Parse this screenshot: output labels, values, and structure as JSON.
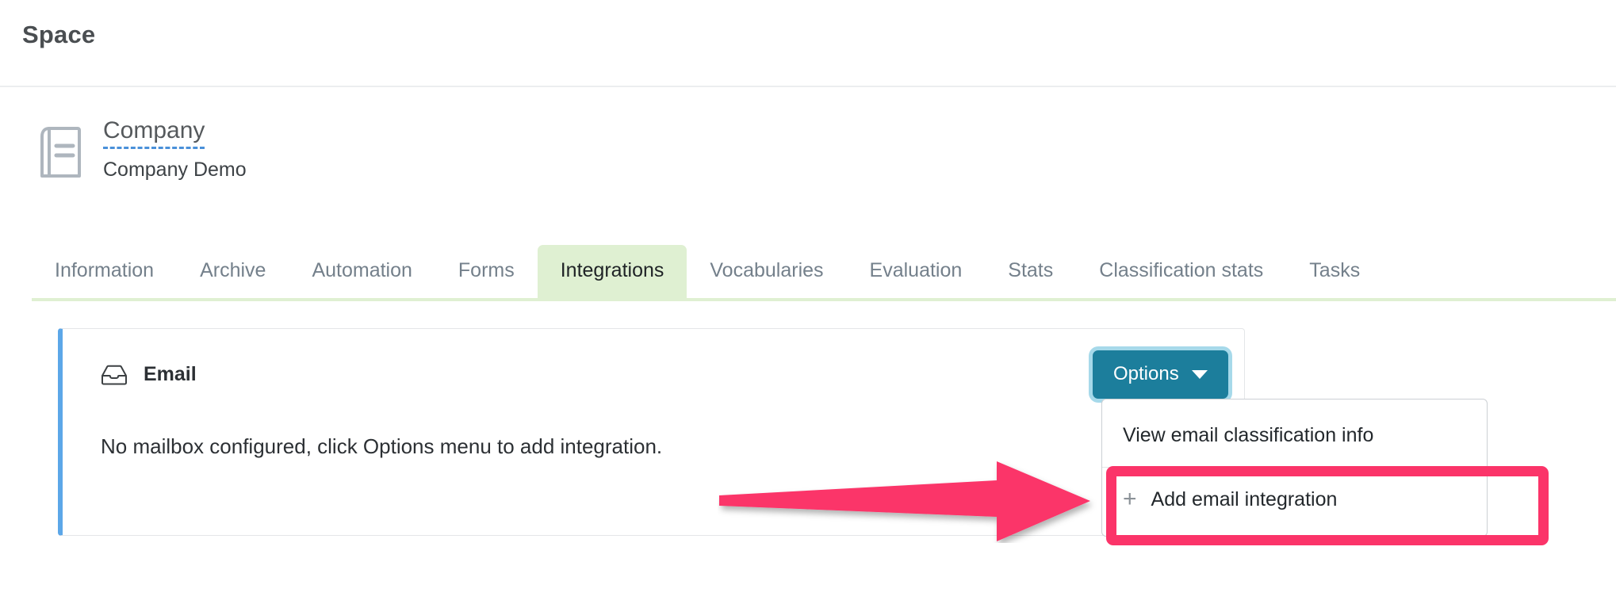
{
  "topbar": {
    "title": "Space"
  },
  "space": {
    "icon": "book-icon",
    "name": "Company",
    "subtitle": "Company Demo"
  },
  "tabs": [
    {
      "label": "Information",
      "active": false
    },
    {
      "label": "Archive",
      "active": false
    },
    {
      "label": "Automation",
      "active": false
    },
    {
      "label": "Forms",
      "active": false
    },
    {
      "label": "Integrations",
      "active": true
    },
    {
      "label": "Vocabularies",
      "active": false
    },
    {
      "label": "Evaluation",
      "active": false
    },
    {
      "label": "Stats",
      "active": false
    },
    {
      "label": "Classification stats",
      "active": false
    },
    {
      "label": "Tasks",
      "active": false
    }
  ],
  "card": {
    "icon": "inbox-tray-icon",
    "title": "Email",
    "body": "No mailbox configured, click Options menu to add integration.",
    "accent_color": "#5ca7e8"
  },
  "options_button": {
    "label": "Options",
    "icon": "chevron-down-icon",
    "color": "#1c7e9c",
    "focus_ring_color": "#5dbad8",
    "expanded": true
  },
  "dropdown": {
    "items": [
      {
        "label": "View email classification info",
        "icon": null,
        "highlighted": false
      },
      {
        "label": "Add email integration",
        "icon": "plus-icon",
        "highlighted": true
      }
    ]
  },
  "annotations": {
    "color": "#fb3469",
    "arrow": "arrow-right",
    "highlight_box_target": "Add email integration"
  }
}
